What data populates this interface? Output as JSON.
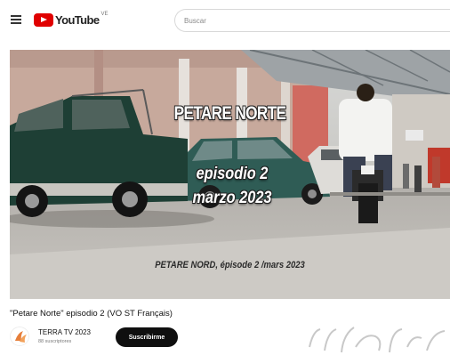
{
  "header": {
    "logo_text": "YouTube",
    "logo_region": "VE",
    "search_placeholder": "Buscar",
    "search_value": ""
  },
  "player": {
    "overlay_title": "PETARE NORTE",
    "overlay_episode": "episodio 2",
    "overlay_date": "marzo 2023",
    "overlay_subtitle": "PETARE NORD, épisode 2 /mars 2023"
  },
  "video": {
    "title": "\"Petare Norte\" episodio 2 (VO ST Français)"
  },
  "channel": {
    "name": "TERRA TV 2023",
    "subscribers": "88 suscriptores",
    "subscribe_label": "Suscribirme"
  },
  "colors": {
    "brand_red": "#e00000",
    "subscribe_bg": "#0f0f0f"
  }
}
